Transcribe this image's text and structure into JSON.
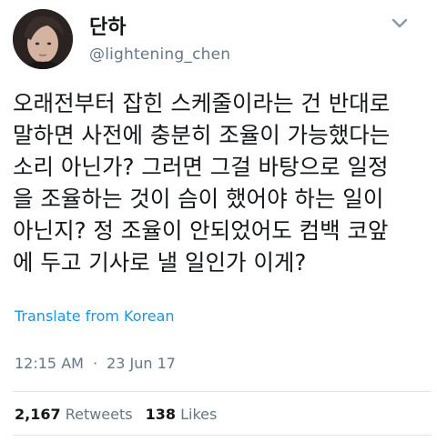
{
  "user": {
    "display_name": "단하",
    "handle": "@lightening_chen"
  },
  "tweet": {
    "text": "오래전부터 잡힌 스케줄이라는 건 반대로\n말하면 사전에 충분히 조율이 가능했다는\n소리 아닌가? 그러면 그걸 바탕으로 일정\n을 조율하는 것이 슴이 했어야 하는 일이\n아닌지? 정 조율이 안되었어도 컴백 코앞\n에 두고 기사로 낼 일인가 이게?",
    "translate_label": "Translate from Korean",
    "time": "12:15 AM",
    "separator": "·",
    "date": "23 Jun 17"
  },
  "stats": {
    "retweets_count": "2,167",
    "retweets_label": "Retweets",
    "likes_count": "138",
    "likes_label": "Likes"
  },
  "icons": {
    "menu": "chevron-down-icon"
  },
  "colors": {
    "link": "#1b95e0",
    "muted": "#657786",
    "text": "#14171a",
    "divider": "#e1e8ed"
  }
}
